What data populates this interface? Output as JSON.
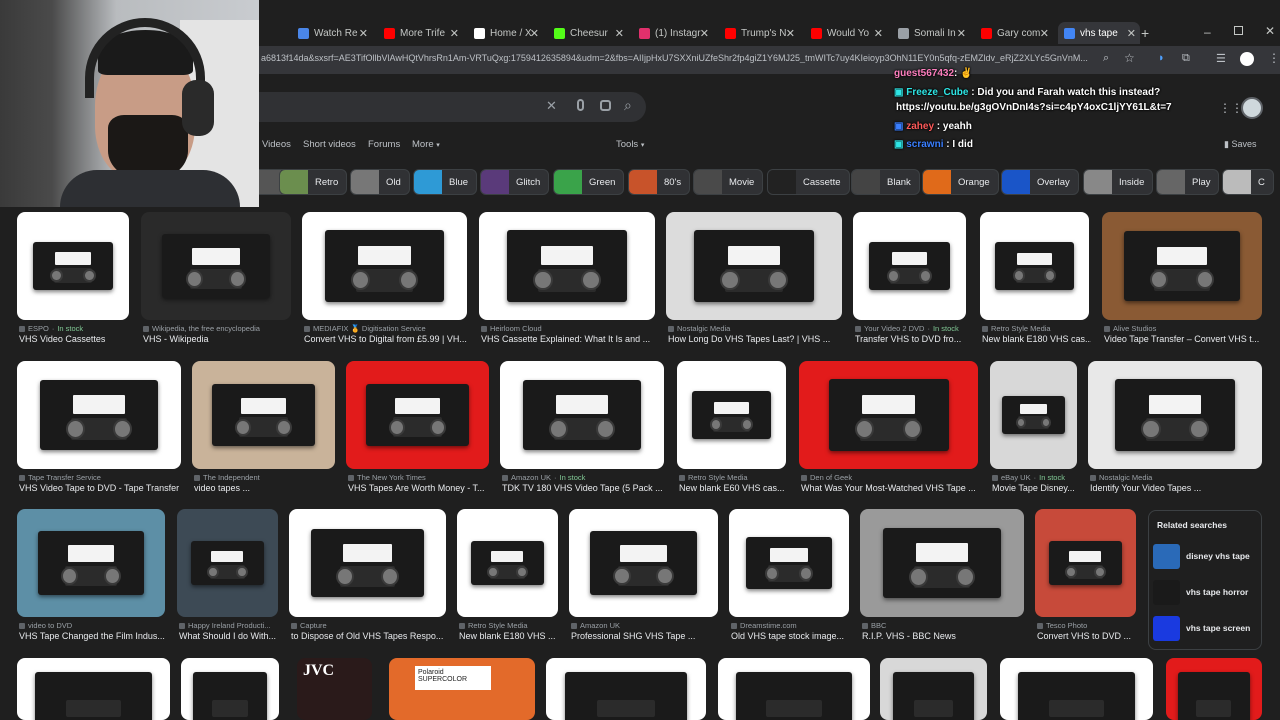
{
  "tabs": [
    {
      "title": "Watch Re",
      "color": "#4a86e8"
    },
    {
      "title": "More Trife",
      "color": "#ff0000"
    },
    {
      "title": "Home / X",
      "color": "#ffffff"
    },
    {
      "title": "Cheesur",
      "color": "#53fc18"
    },
    {
      "title": "(1) Instagr",
      "color": "#e1306c"
    },
    {
      "title": "Trump's N",
      "color": "#ff0000"
    },
    {
      "title": "Would Yo",
      "color": "#ff0000"
    },
    {
      "title": "Somali In",
      "color": "#9aa0a6"
    },
    {
      "title": "Gary com",
      "color": "#ff0000"
    },
    {
      "title": "vhs tape",
      "color": "#4285f4"
    }
  ],
  "address": {
    "url": "a6813f14da&sxsrf=AE3TifOllbVlAwHQtVhrsRn1Am-VRTuQxg:1759412635894&udm=2&fbs=AIIjpHxU7SXXniUZfeShr2fp4giZ1Y6MJ25_tmWITc7uy4KIeioyp3OhN11EY0n5qfq-zEMZldv_eRjZ2XLYc5GnVnM..."
  },
  "search": {
    "nav": [
      "Videos",
      "Short videos",
      "Forums",
      "More",
      "Tools"
    ],
    "saves": "Saves"
  },
  "chips": [
    {
      "label": "y",
      "color": "#555"
    },
    {
      "label": "Retro",
      "color": "#6b8e4e"
    },
    {
      "label": "Old",
      "color": "#777"
    },
    {
      "label": "Blue",
      "color": "#2e9ad6"
    },
    {
      "label": "Glitch",
      "color": "#5a3a7a"
    },
    {
      "label": "Green",
      "color": "#3aa34a"
    },
    {
      "label": "80's",
      "color": "#c8532a"
    },
    {
      "label": "Movie",
      "color": "#4a4a4a"
    },
    {
      "label": "Cassette",
      "color": "#222"
    },
    {
      "label": "Blank",
      "color": "#444"
    },
    {
      "label": "Orange",
      "color": "#e06a1a"
    },
    {
      "label": "Overlay",
      "color": "#1a55c8"
    },
    {
      "label": "Inside",
      "color": "#888"
    },
    {
      "label": "Play",
      "color": "#666"
    },
    {
      "label": "C",
      "color": "#bbb"
    }
  ],
  "results": [
    {
      "source": "ESPO",
      "stock": "In stock",
      "title": "VHS Video Cassettes",
      "bg": "#ffffff"
    },
    {
      "source": "Wikipedia, the free encyclopedia",
      "stock": "",
      "title": "VHS - Wikipedia",
      "bg": "#2a2a2a"
    },
    {
      "source": "MEDIAFIX 🏅 Digitisation Service",
      "stock": "",
      "title": "Convert VHS to Digital from £5.99 | VH...",
      "bg": "#ffffff"
    },
    {
      "source": "Heirloom Cloud",
      "stock": "",
      "title": "VHS Cassette Explained: What It Is and ...",
      "bg": "#ffffff"
    },
    {
      "source": "Nostalgic Media",
      "stock": "",
      "title": "How Long Do VHS Tapes Last? | VHS ...",
      "bg": "#dcdcdc"
    },
    {
      "source": "Your Video 2 DVD",
      "stock": "In stock",
      "title": "Transfer VHS to DVD fro...",
      "bg": "#ffffff"
    },
    {
      "source": "Retro Style Media",
      "stock": "",
      "title": "New blank E180 VHS cas...",
      "bg": "#ffffff"
    },
    {
      "source": "Alive Studios",
      "stock": "",
      "title": "Video Tape Transfer – Convert VHS t...",
      "bg": "#8a5a34"
    },
    {
      "source": "Tape Transfer Service",
      "stock": "",
      "title": "VHS Video Tape to DVD - Tape Transfer",
      "bg": "#ffffff"
    },
    {
      "source": "The Independent",
      "stock": "",
      "title": "video tapes ...",
      "bg": "#c9b39a"
    },
    {
      "source": "The New York Times",
      "stock": "",
      "title": "VHS Tapes Are Worth Money - T...",
      "bg": "#e21b1b"
    },
    {
      "source": "Amazon UK",
      "stock": "In stock",
      "title": "TDK TV 180 VHS Video Tape (5 Pack ...",
      "bg": "#ffffff"
    },
    {
      "source": "Retro Style Media",
      "stock": "",
      "title": "New blank E60 VHS cas...",
      "bg": "#ffffff"
    },
    {
      "source": "Den of Geek",
      "stock": "",
      "title": "What Was Your Most-Watched VHS Tape ...",
      "bg": "#e21b1b"
    },
    {
      "source": "eBay UK",
      "stock": "In stock",
      "title": "Movie Tape Disney...",
      "bg": "#d8d8d8"
    },
    {
      "source": "Nostalgic Media",
      "stock": "",
      "title": "Identify Your Video Tapes ...",
      "bg": "#e8e8e8"
    },
    {
      "source": "video to DVD",
      "stock": "",
      "title": "VHS Tape Changed the Film Indus...",
      "bg": "#5d8fa6"
    },
    {
      "source": "Happy Ireland Producti...",
      "stock": "",
      "title": "What Should I do With...",
      "bg": "#3d4a55"
    },
    {
      "source": "Capture",
      "stock": "",
      "title": "to Dispose of Old VHS Tapes Respo...",
      "bg": "#ffffff"
    },
    {
      "source": "Retro Style Media",
      "stock": "",
      "title": "New blank E180 VHS ...",
      "bg": "#ffffff"
    },
    {
      "source": "Amazon UK",
      "stock": "",
      "title": "Professional SHG VHS Tape ...",
      "bg": "#ffffff"
    },
    {
      "source": "Dreamstime.com",
      "stock": "",
      "title": "Old VHS tape stock image...",
      "bg": "#ffffff"
    },
    {
      "source": "BBC",
      "stock": "",
      "title": "R.I.P. VHS - BBC News",
      "bg": "#9a9a9a"
    },
    {
      "source": "Tesco Photo",
      "stock": "",
      "title": "Convert VHS to DVD ...",
      "bg": "#c74a3a"
    }
  ],
  "bottom_row_colors": [
    "#ffffff",
    "#ffffff",
    "#2a1a1a",
    "#e36a2a",
    "#ffffff",
    "#ffffff",
    "#d8d8d8",
    "#ffffff",
    "#e21b1b"
  ],
  "bottom_row_labels": [
    "JVC",
    "Polaroid SUPERCOLOR"
  ],
  "related": {
    "heading": "Related searches",
    "items": [
      {
        "label": "disney vhs tape",
        "color": "#2a6ab8"
      },
      {
        "label": "vhs tape horror",
        "color": "#1a1a1a"
      },
      {
        "label": "vhs tape screen",
        "color": "#1a3ae0"
      }
    ]
  },
  "chat": [
    {
      "user": "guest567432",
      "msg": "",
      "color": "#ff7fbf"
    },
    {
      "user": "Freeze_Cube",
      "msg": "Did you and Farah watch this instead?",
      "color": "#2ee6e6"
    },
    {
      "user": "",
      "msg": "https://youtu.be/g3gOVnDnI4s?si=c4pY4oxC1ljYY61L&t=7",
      "color": "#ffffff"
    },
    {
      "user": "zahey",
      "msg": "yeahh",
      "color": "#ff5a5a"
    },
    {
      "user": "scrawni",
      "msg": "I did",
      "color": "#3a7fff"
    }
  ]
}
